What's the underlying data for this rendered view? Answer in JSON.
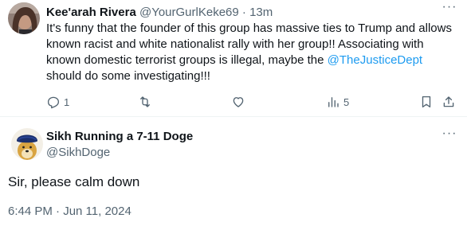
{
  "original_tweet": {
    "display_name": "Kee'arah Rivera",
    "handle": "@YourGurlKeke69",
    "separator": " · ",
    "time": "13m",
    "text_before_mention": "It's funny that the founder of this group has massive ties to Trump and allows known racist and white nationalist rally with her group!! Associating with known domestic terrorist groups is illegal, maybe the ",
    "mention": "@TheJusticeDept",
    "text_after_mention": "  should do some investigating!!!",
    "more_label": "···",
    "actions": {
      "reply_count": "1",
      "retweet_count": "",
      "like_count": "",
      "views_count": "5"
    },
    "icons": [
      "reply-icon",
      "retweet-icon",
      "like-icon",
      "views-icon",
      "bookmark-icon",
      "share-icon"
    ]
  },
  "reply_tweet": {
    "display_name": "Sikh Running a 7-11 Doge",
    "handle": "@SikhDoge",
    "more_label": "···",
    "text": "Sir, please calm down",
    "timestamp": "6:44 PM · Jun 11, 2024"
  },
  "colors": {
    "text_primary": "#0f1419",
    "text_secondary": "#536471",
    "link": "#1d9bf0",
    "divider": "#eff3f4"
  }
}
